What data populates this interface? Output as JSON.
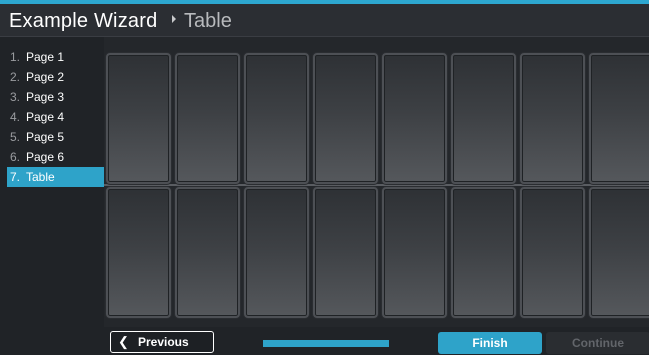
{
  "header": {
    "title": "Example Wizard",
    "breadcrumb": "Table"
  },
  "sidebar": {
    "items": [
      {
        "num": "1.",
        "label": "Page 1"
      },
      {
        "num": "2.",
        "label": "Page 2"
      },
      {
        "num": "3.",
        "label": "Page 3"
      },
      {
        "num": "4.",
        "label": "Page 4"
      },
      {
        "num": "5.",
        "label": "Page 5"
      },
      {
        "num": "6.",
        "label": "Page 6"
      },
      {
        "num": "7.",
        "label": "Table"
      }
    ],
    "active_index": 6
  },
  "table": {
    "rows": 2,
    "columns": 8
  },
  "footer": {
    "previous_label": "Previous",
    "finish_label": "Finish",
    "continue_label": "Continue",
    "progress": 1.0
  },
  "colors": {
    "accent": "#2ea3c9",
    "background": "#202327",
    "header": "#2b2e33"
  },
  "icons": {
    "previous": "chevron-left-icon",
    "breadcrumb_separator": "triangle-right-icon"
  }
}
